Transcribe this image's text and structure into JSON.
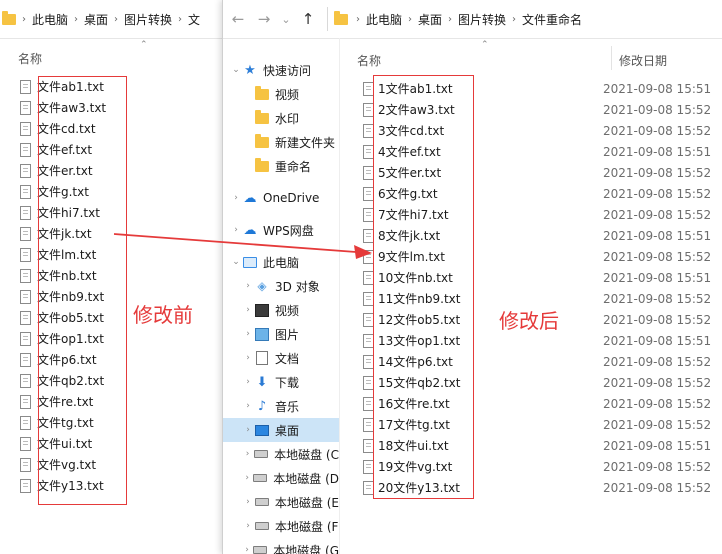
{
  "left_window": {
    "breadcrumb": [
      "此电脑",
      "桌面",
      "图片转换",
      "文"
    ],
    "column_name": "名称",
    "files": [
      "文件ab1.txt",
      "文件aw3.txt",
      "文件cd.txt",
      "文件ef.txt",
      "文件er.txt",
      "文件g.txt",
      "文件hi7.txt",
      "文件jk.txt",
      "文件lm.txt",
      "文件nb.txt",
      "文件nb9.txt",
      "文件ob5.txt",
      "文件op1.txt",
      "文件p6.txt",
      "文件qb2.txt",
      "文件re.txt",
      "文件tg.txt",
      "文件ui.txt",
      "文件vg.txt",
      "文件y13.txt"
    ],
    "annotation": "修改前"
  },
  "right_window": {
    "nav_buttons": [
      "←",
      "→",
      "⌄",
      "↑"
    ],
    "breadcrumb": [
      "此电脑",
      "桌面",
      "图片转换",
      "文件重命名"
    ],
    "column_name": "名称",
    "column_date": "修改日期",
    "nav_pane": [
      {
        "label": "快速访问",
        "icon": "star-icon",
        "chevron": "⌄"
      },
      {
        "label": "视频",
        "icon": "folder-icon",
        "chevron": ""
      },
      {
        "label": "水印",
        "icon": "folder-icon",
        "chevron": ""
      },
      {
        "label": "新建文件夹",
        "icon": "folder-icon",
        "chevron": ""
      },
      {
        "label": "重命名",
        "icon": "folder-icon",
        "chevron": ""
      },
      {
        "label": "OneDrive",
        "icon": "cloud-icon",
        "chevron": "›"
      },
      {
        "label": "WPS网盘",
        "icon": "cloud-icon",
        "chevron": "›"
      },
      {
        "label": "此电脑",
        "icon": "computer-icon",
        "chevron": "⌄"
      },
      {
        "label": "3D 对象",
        "icon": "cube-icon",
        "chevron": "›"
      },
      {
        "label": "视频",
        "icon": "video-icon",
        "chevron": "›"
      },
      {
        "label": "图片",
        "icon": "picture-icon",
        "chevron": "›"
      },
      {
        "label": "文档",
        "icon": "document-icon",
        "chevron": "›"
      },
      {
        "label": "下载",
        "icon": "download-icon",
        "chevron": "›"
      },
      {
        "label": "音乐",
        "icon": "music-icon",
        "chevron": "›"
      },
      {
        "label": "桌面",
        "icon": "desktop-icon",
        "chevron": "›"
      },
      {
        "label": "本地磁盘 (C",
        "icon": "drive-icon",
        "chevron": "›"
      },
      {
        "label": "本地磁盘 (D",
        "icon": "drive-icon",
        "chevron": "›"
      },
      {
        "label": "本地磁盘 (E",
        "icon": "drive-icon",
        "chevron": "›"
      },
      {
        "label": "本地磁盘 (F",
        "icon": "drive-icon",
        "chevron": "›"
      },
      {
        "label": "本地磁盘 (G",
        "icon": "drive-icon",
        "chevron": "›"
      }
    ],
    "files": [
      {
        "name": "1文件ab1.txt",
        "date": "2021-09-08 15:51"
      },
      {
        "name": "2文件aw3.txt",
        "date": "2021-09-08 15:52"
      },
      {
        "name": "3文件cd.txt",
        "date": "2021-09-08 15:52"
      },
      {
        "name": "4文件ef.txt",
        "date": "2021-09-08 15:51"
      },
      {
        "name": "5文件er.txt",
        "date": "2021-09-08 15:52"
      },
      {
        "name": "6文件g.txt",
        "date": "2021-09-08 15:52"
      },
      {
        "name": "7文件hi7.txt",
        "date": "2021-09-08 15:52"
      },
      {
        "name": "8文件jk.txt",
        "date": "2021-09-08 15:51"
      },
      {
        "name": "9文件lm.txt",
        "date": "2021-09-08 15:52"
      },
      {
        "name": "10文件nb.txt",
        "date": "2021-09-08 15:51"
      },
      {
        "name": "11文件nb9.txt",
        "date": "2021-09-08 15:52"
      },
      {
        "name": "12文件ob5.txt",
        "date": "2021-09-08 15:52"
      },
      {
        "name": "13文件op1.txt",
        "date": "2021-09-08 15:51"
      },
      {
        "name": "14文件p6.txt",
        "date": "2021-09-08 15:52"
      },
      {
        "name": "15文件qb2.txt",
        "date": "2021-09-08 15:52"
      },
      {
        "name": "16文件re.txt",
        "date": "2021-09-08 15:52"
      },
      {
        "name": "17文件tg.txt",
        "date": "2021-09-08 15:52"
      },
      {
        "name": "18文件ui.txt",
        "date": "2021-09-08 15:51"
      },
      {
        "name": "19文件vg.txt",
        "date": "2021-09-08 15:52"
      },
      {
        "name": "20文件y13.txt",
        "date": "2021-09-08 15:52"
      }
    ],
    "annotation": "修改后"
  },
  "colors": {
    "annotation_red": "#e53a3a",
    "selected_bg": "#cce4f7",
    "folder_yellow": "#f6c342"
  }
}
